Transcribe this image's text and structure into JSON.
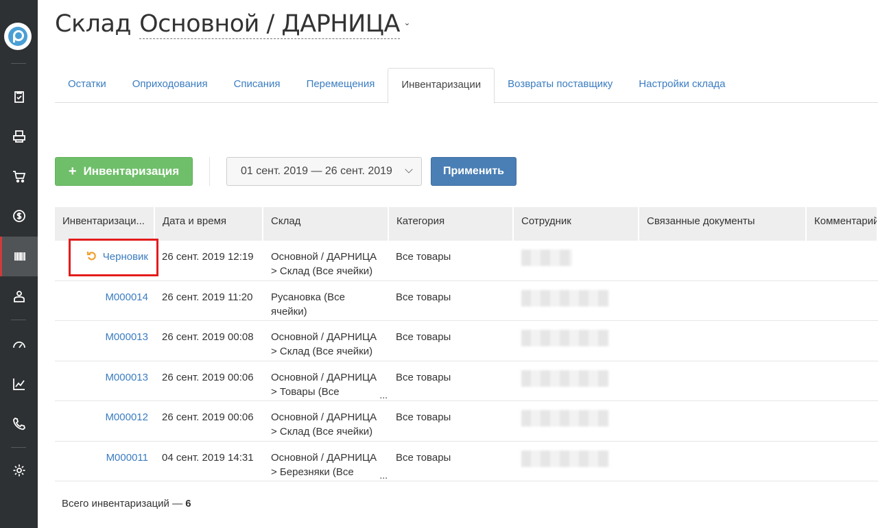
{
  "sidebar": {
    "logo": "logo-icon",
    "items": [
      {
        "icon": "clipboard-check-icon",
        "active": false
      },
      {
        "icon": "printer-icon",
        "active": false
      },
      {
        "icon": "cart-icon",
        "active": false
      },
      {
        "icon": "dollar-icon",
        "active": false
      },
      {
        "icon": "barcode-icon",
        "active": true
      },
      {
        "icon": "user-icon",
        "active": false
      },
      {
        "icon": "speedometer-icon",
        "active": false
      },
      {
        "icon": "chart-icon",
        "active": false
      },
      {
        "icon": "phone-icon",
        "active": false
      },
      {
        "icon": "gear-icon",
        "active": false
      }
    ]
  },
  "header": {
    "title_static": "Склад",
    "title_link": "Основной / ДАРНИЦА",
    "caret": "ˇ"
  },
  "tabs": [
    {
      "label": "Остатки",
      "active": false
    },
    {
      "label": "Оприходования",
      "active": false
    },
    {
      "label": "Списания",
      "active": false
    },
    {
      "label": "Перемещения",
      "active": false
    },
    {
      "label": "Инвентаризации",
      "active": true
    },
    {
      "label": "Возвраты поставщику",
      "active": false
    },
    {
      "label": "Настройки склада",
      "active": false
    }
  ],
  "toolbar": {
    "add_label": "Инвентаризация",
    "add_plus": "+",
    "date_range": "01 сент. 2019 — 26 сент. 2019",
    "apply_label": "Применить"
  },
  "table": {
    "columns": [
      "Инвентаризаци...",
      "Дата и время",
      "Склад",
      "Категория",
      "Сотрудник",
      "Связанные документы",
      "Комментарий"
    ],
    "rows": [
      {
        "id": "Черновик",
        "draft": true,
        "datetime": "26 сент. 2019 12:19",
        "warehouse_1": "Основной / ДАРНИЦА",
        "warehouse_2": "> Склад (Все ячейки)",
        "truncated": false,
        "category": "Все товары"
      },
      {
        "id": "M000014",
        "draft": false,
        "datetime": "26 сент. 2019 11:20",
        "warehouse_1": "Русановка (Все",
        "warehouse_2": "ячейки)",
        "truncated": false,
        "category": "Все товары"
      },
      {
        "id": "M000013",
        "draft": false,
        "datetime": "26 сент. 2019 00:08",
        "warehouse_1": "Основной / ДАРНИЦА",
        "warehouse_2": "> Склад (Все ячейки)",
        "truncated": false,
        "category": "Все товары"
      },
      {
        "id": "M000013",
        "draft": false,
        "datetime": "26 сент. 2019 00:06",
        "warehouse_1": "Основной / ДАРНИЦА",
        "warehouse_2": "> Товары (Все",
        "truncated": true,
        "category": "Все товары"
      },
      {
        "id": "M000012",
        "draft": false,
        "datetime": "26 сент. 2019 00:06",
        "warehouse_1": "Основной / ДАРНИЦА",
        "warehouse_2": "> Склад (Все ячейки)",
        "truncated": false,
        "category": "Все товары"
      },
      {
        "id": "M000011",
        "draft": false,
        "datetime": "04 сент. 2019 14:31",
        "warehouse_1": "Основной / ДАРНИЦА",
        "warehouse_2": "> Березняки (Все",
        "truncated": true,
        "category": "Все товары"
      }
    ]
  },
  "footer": {
    "total_label": "Всего инвентаризаций —",
    "total_count": "6"
  },
  "ellipsis": "..."
}
